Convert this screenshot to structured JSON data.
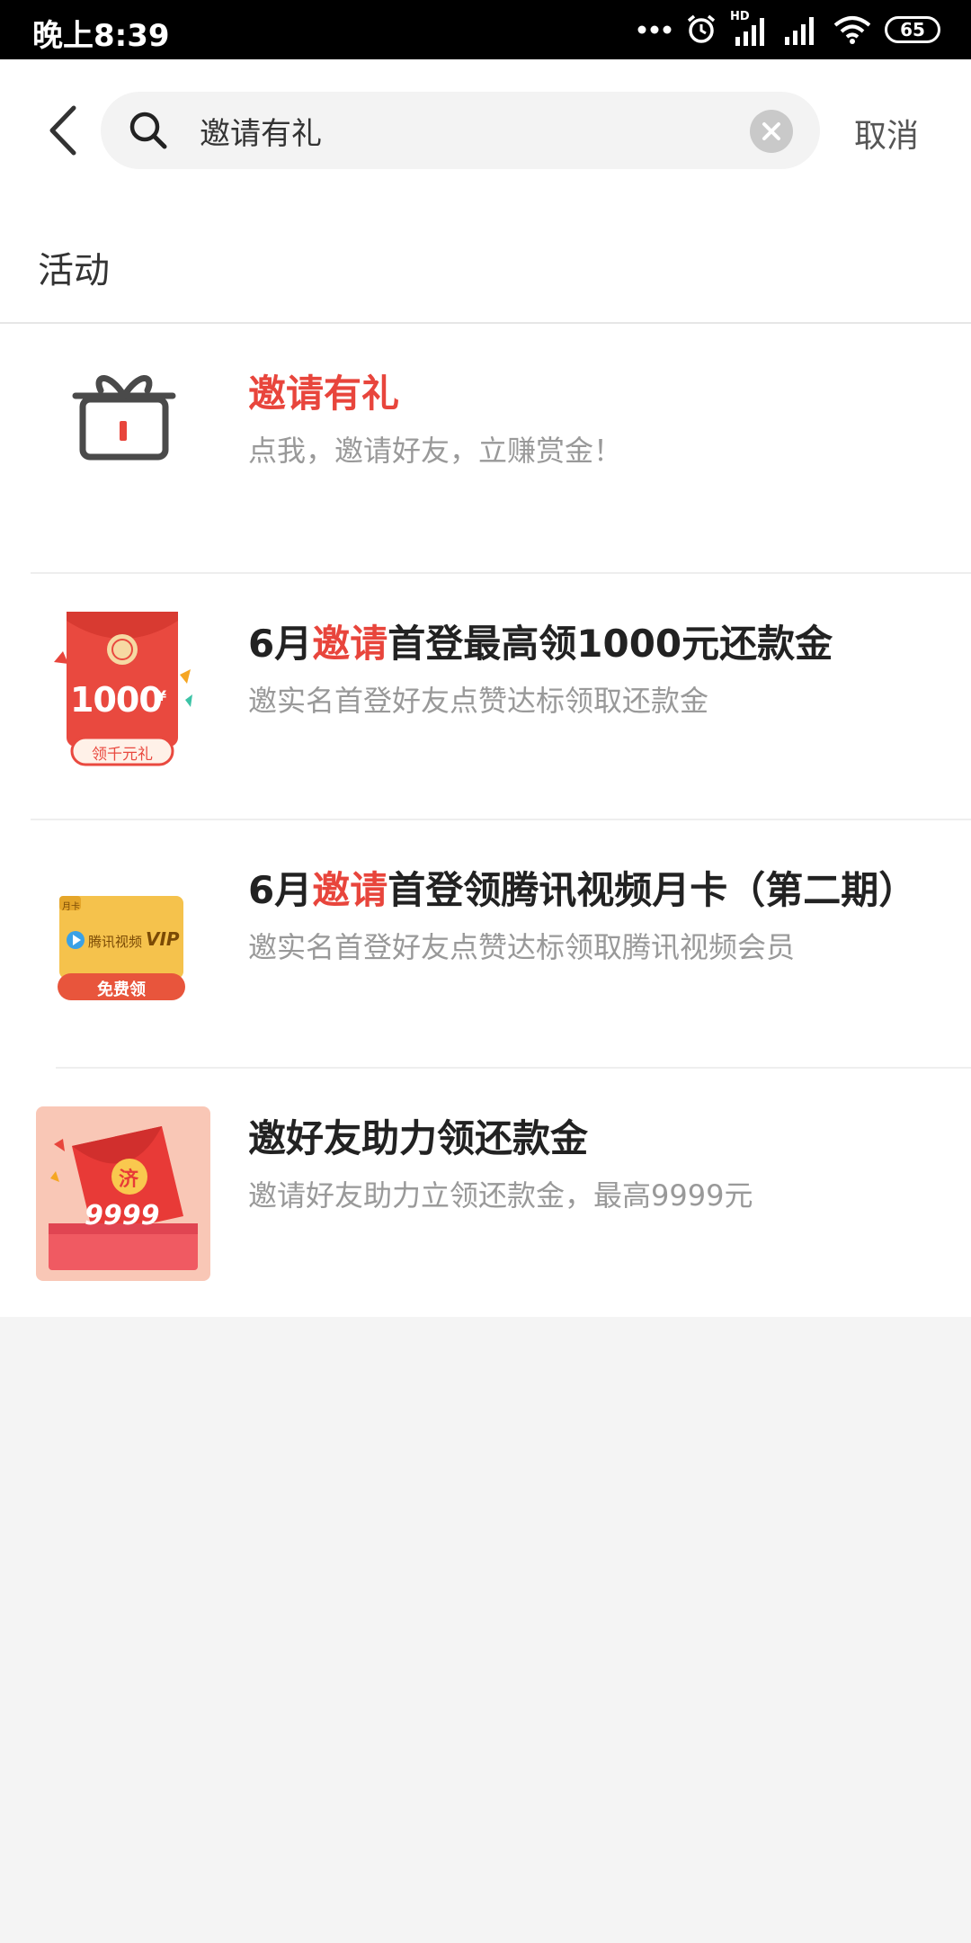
{
  "status": {
    "time": "晚上8:39",
    "battery": "65",
    "network_label": "HD"
  },
  "search": {
    "value": "邀请有礼",
    "cancel": "取消"
  },
  "section": {
    "title": "活动"
  },
  "items": [
    {
      "title": "邀请有礼",
      "desc": "点我，邀请好友，立赚赏金！"
    },
    {
      "title_pre": "6月",
      "title_hl": "邀请",
      "title_post": "首登最高领1000元还款金",
      "desc": "邀实名首登好友点赞达标领取还款金",
      "thumb_amount": "1000",
      "thumb_currency": "¥",
      "thumb_badge": "领千元礼"
    },
    {
      "title_pre": "6月",
      "title_hl": "邀请",
      "title_post": "首登领腾讯视频月卡（第二期）",
      "desc": "邀实名首登好友点赞达标领取腾讯视频会员",
      "thumb_tag": "月卡",
      "thumb_brand": "腾讯视频",
      "thumb_vip": "VIP",
      "thumb_badge": "免费领"
    },
    {
      "title": "邀好友助力领还款金",
      "desc": "邀请好友助力立领还款金，最高9999元",
      "thumb_amount": "9999",
      "thumb_char": "济"
    }
  ],
  "colors": {
    "highlight": "#e8453c",
    "background": "#f4f4f4",
    "muted": "#999999"
  }
}
